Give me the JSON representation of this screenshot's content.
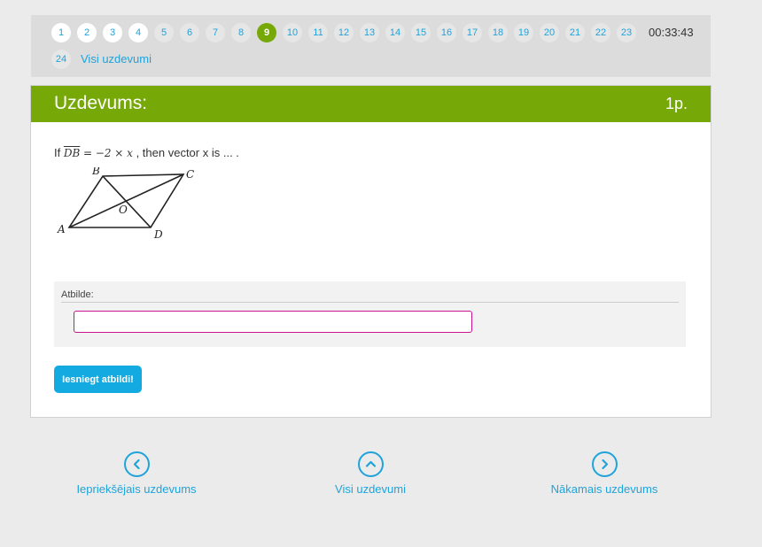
{
  "top_nav": {
    "pages": [
      {
        "label": "1",
        "state": "visited"
      },
      {
        "label": "2",
        "state": "visited"
      },
      {
        "label": "3",
        "state": "visited"
      },
      {
        "label": "4",
        "state": "visited"
      },
      {
        "label": "5",
        "state": "unvisited"
      },
      {
        "label": "6",
        "state": "unvisited"
      },
      {
        "label": "7",
        "state": "unvisited"
      },
      {
        "label": "8",
        "state": "unvisited"
      },
      {
        "label": "9",
        "state": "current"
      },
      {
        "label": "10",
        "state": "unvisited"
      },
      {
        "label": "11",
        "state": "unvisited"
      },
      {
        "label": "12",
        "state": "unvisited"
      },
      {
        "label": "13",
        "state": "unvisited"
      },
      {
        "label": "14",
        "state": "unvisited"
      },
      {
        "label": "15",
        "state": "unvisited"
      },
      {
        "label": "16",
        "state": "unvisited"
      },
      {
        "label": "17",
        "state": "unvisited"
      },
      {
        "label": "18",
        "state": "unvisited"
      },
      {
        "label": "19",
        "state": "unvisited"
      },
      {
        "label": "20",
        "state": "unvisited"
      },
      {
        "label": "21",
        "state": "unvisited"
      },
      {
        "label": "22",
        "state": "unvisited"
      },
      {
        "label": "23",
        "state": "unvisited"
      },
      {
        "label": "24",
        "state": "unvisited"
      }
    ],
    "timer": "00:33:43",
    "all_tasks_link": "Visi uzdevumi"
  },
  "task": {
    "title": "Uzdevums:",
    "points": "1p.",
    "question_prefix": "If",
    "vector_db": "DB",
    "equation": "= −2 × x",
    "question_suffix": ", then vector x is ... .",
    "figure_labels": {
      "a": "A",
      "b": "B",
      "c": "C",
      "d": "D",
      "o": "O"
    },
    "answer_label": "Atbilde:",
    "answer_value": "",
    "submit_label": "Iesniegt atbildi!"
  },
  "bottom_nav": {
    "prev_label": "Iepriekšējais uzdevums",
    "all_label": "Visi uzdevumi",
    "next_label": "Nākamais uzdevums"
  },
  "colors": {
    "accent_green": "#76a808",
    "link_blue": "#1fa3db",
    "button_blue": "#13aae2",
    "input_border": "#c8158f"
  }
}
